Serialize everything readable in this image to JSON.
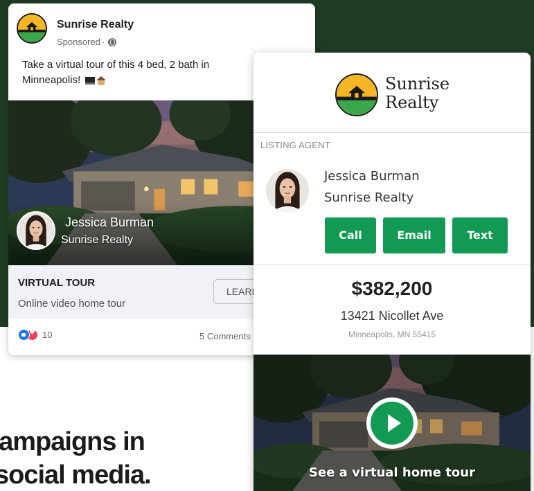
{
  "ad": {
    "page_name": "Sunrise Realty",
    "sponsored": "Sponsored",
    "separator": "·",
    "caption": "Take a virtual tour of this 4 bed, 2 bath in Minneapolis!",
    "agent_name": "Jessica Burman",
    "agent_company": "Sunrise Realty",
    "cta_title": "VIRTUAL TOUR",
    "cta_subtitle": "Online video home tour",
    "cta_button": "LEARN MORE",
    "reaction_count": "10",
    "comments": "5 Comments",
    "icons": [
      "globe-icon",
      "laptop-emoji",
      "house-emoji",
      "like-icon",
      "love-icon"
    ]
  },
  "landing": {
    "brand_line1": "Sunrise",
    "brand_line2": "Realty",
    "section_label": "LISTING AGENT",
    "agent_name": "Jessica Burman",
    "agent_company": "Sunrise Realty",
    "buttons": {
      "call": "Call",
      "email": "Email",
      "text": "Text"
    },
    "price": "$382,200",
    "street": "13421 Nicollet Ave",
    "city": "Minneapolis, MN 55415",
    "video_caption": "See a virtual home tour",
    "accent_color": "#129a55"
  },
  "headline": {
    "line1": "campaigns in",
    "line2": "social media."
  },
  "colors": {
    "background_dark": "#1f3d23",
    "button_green": "#129a55",
    "facebook_blue": "#1877f2"
  }
}
